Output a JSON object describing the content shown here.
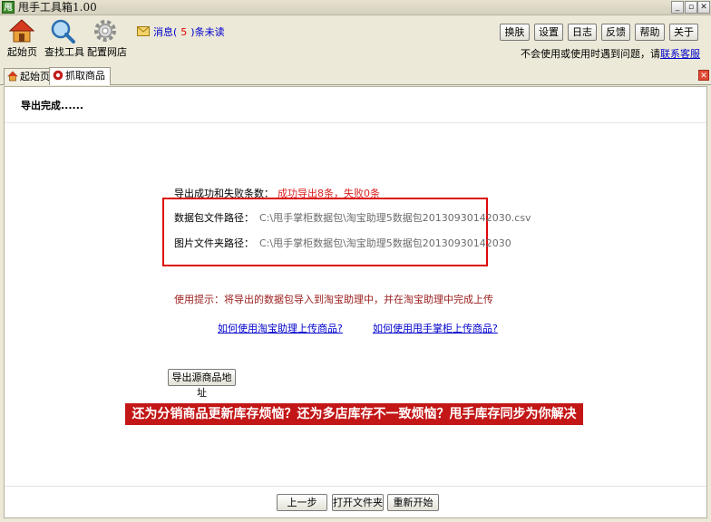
{
  "window": {
    "title": "甩手工具箱1.00",
    "app_icon_text": "甩",
    "controls": {
      "minimize": "_",
      "restore": "▫",
      "close": "✕"
    }
  },
  "toolbar": {
    "tools": [
      {
        "label": "起始页",
        "icon": "home-icon"
      },
      {
        "label": "查找工具",
        "icon": "magnifier-icon"
      },
      {
        "label": "配置网店",
        "icon": "gear-icon"
      }
    ],
    "message": {
      "prefix": "消息(",
      "count": "5",
      "suffix": ")条未读"
    },
    "buttons": [
      "换肤",
      "设置",
      "日志",
      "反馈",
      "帮助",
      "关于"
    ],
    "help_text": "不会使用或使用时遇到问题，请",
    "help_link": "联系客服"
  },
  "tabs": [
    {
      "label": "起始页",
      "icon": "home-icon"
    },
    {
      "label": "抓取商品",
      "icon": "grab-icon",
      "active": true
    }
  ],
  "main": {
    "status": "导出完成......",
    "result_label": "导出成功和失败条数：",
    "result_value": "成功导出8条，失败0条",
    "package_label": "数据包文件路径：",
    "package_value": "C:\\甩手掌柜数据包\\淘宝助理5数据包20130930142030.csv",
    "image_label": "图片文件夹路径：",
    "image_value": "C:\\甩手掌柜数据包\\淘宝助理5数据包20130930142030",
    "tip": "使用提示：将导出的数据包导入到淘宝助理中，并在淘宝助理中完成上传",
    "link1": "如何使用淘宝助理上传商品?",
    "link2": "如何使用甩手掌柜上传商品?",
    "export_source_button": "导出源商品地址",
    "banner": "还为分销商品更新库存烦恼？还为多店库存不一致烦恼？甩手库存同步为你解决"
  },
  "footer": {
    "buttons": [
      "上一步",
      "打开文件夹",
      "重新开始"
    ]
  }
}
